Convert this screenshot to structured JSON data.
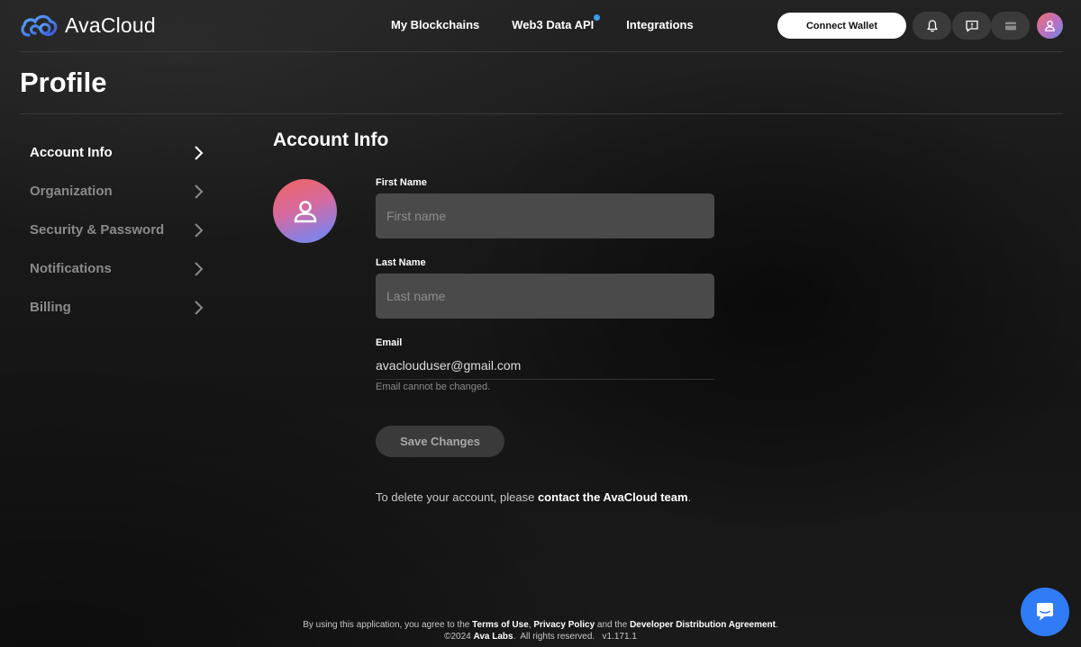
{
  "header": {
    "logo_text": "AvaCloud",
    "nav": [
      {
        "label": "My Blockchains"
      },
      {
        "label": "Web3 Data API"
      },
      {
        "label": "Integrations"
      }
    ],
    "connect_wallet_label": "Connect Wallet",
    "icons": [
      "bell-icon",
      "feedback-icon",
      "wallet-icon",
      "user-icon"
    ]
  },
  "page": {
    "title": "Profile"
  },
  "sidebar": {
    "items": [
      {
        "label": "Account Info",
        "active": true
      },
      {
        "label": "Organization",
        "active": false
      },
      {
        "label": "Security & Password",
        "active": false
      },
      {
        "label": "Notifications",
        "active": false
      },
      {
        "label": "Billing",
        "active": false
      }
    ]
  },
  "main": {
    "section_title": "Account Info",
    "first_name": {
      "label": "First Name",
      "placeholder": "First name",
      "value": ""
    },
    "last_name": {
      "label": "Last Name",
      "placeholder": "Last name",
      "value": ""
    },
    "email": {
      "label": "Email",
      "value": "avaclouduser@gmail.com",
      "help": "Email cannot be changed."
    },
    "save_label": "Save Changes",
    "delete_prefix": "To delete your account, please ",
    "delete_link": "contact the AvaCloud team",
    "delete_suffix": "."
  },
  "footer": {
    "line1_prefix": "By using this application, you agree to the ",
    "terms": "Terms of Use",
    "sep1": ", ",
    "privacy": "Privacy Policy",
    "sep2": " and the ",
    "dda": "Developer Distribution Agreement",
    "sep3": ".",
    "copyright": "©2024 ",
    "company": "Ava Labs",
    "rights": ".  All rights reserved.   v1.171.1"
  },
  "colors": {
    "accent": "#2f7cf6",
    "notification_dot": "#3a9bf5",
    "background": "#161616"
  }
}
